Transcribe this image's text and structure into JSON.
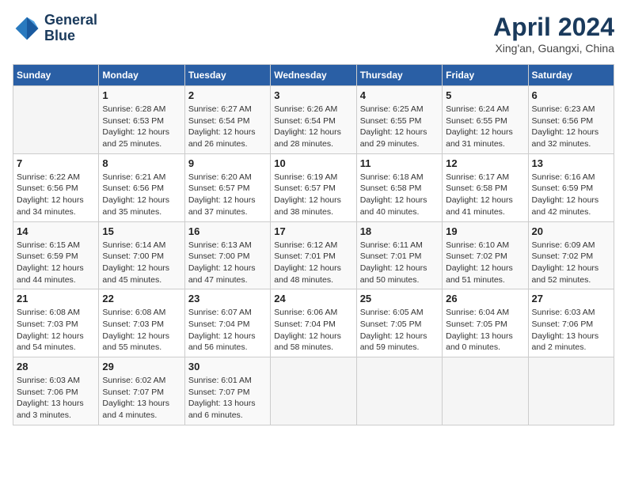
{
  "header": {
    "logo_line1": "General",
    "logo_line2": "Blue",
    "month": "April 2024",
    "location": "Xing'an, Guangxi, China"
  },
  "weekdays": [
    "Sunday",
    "Monday",
    "Tuesday",
    "Wednesday",
    "Thursday",
    "Friday",
    "Saturday"
  ],
  "weeks": [
    [
      {
        "day": "",
        "detail": ""
      },
      {
        "day": "1",
        "detail": "Sunrise: 6:28 AM\nSunset: 6:53 PM\nDaylight: 12 hours\nand 25 minutes."
      },
      {
        "day": "2",
        "detail": "Sunrise: 6:27 AM\nSunset: 6:54 PM\nDaylight: 12 hours\nand 26 minutes."
      },
      {
        "day": "3",
        "detail": "Sunrise: 6:26 AM\nSunset: 6:54 PM\nDaylight: 12 hours\nand 28 minutes."
      },
      {
        "day": "4",
        "detail": "Sunrise: 6:25 AM\nSunset: 6:55 PM\nDaylight: 12 hours\nand 29 minutes."
      },
      {
        "day": "5",
        "detail": "Sunrise: 6:24 AM\nSunset: 6:55 PM\nDaylight: 12 hours\nand 31 minutes."
      },
      {
        "day": "6",
        "detail": "Sunrise: 6:23 AM\nSunset: 6:56 PM\nDaylight: 12 hours\nand 32 minutes."
      }
    ],
    [
      {
        "day": "7",
        "detail": "Sunrise: 6:22 AM\nSunset: 6:56 PM\nDaylight: 12 hours\nand 34 minutes."
      },
      {
        "day": "8",
        "detail": "Sunrise: 6:21 AM\nSunset: 6:56 PM\nDaylight: 12 hours\nand 35 minutes."
      },
      {
        "day": "9",
        "detail": "Sunrise: 6:20 AM\nSunset: 6:57 PM\nDaylight: 12 hours\nand 37 minutes."
      },
      {
        "day": "10",
        "detail": "Sunrise: 6:19 AM\nSunset: 6:57 PM\nDaylight: 12 hours\nand 38 minutes."
      },
      {
        "day": "11",
        "detail": "Sunrise: 6:18 AM\nSunset: 6:58 PM\nDaylight: 12 hours\nand 40 minutes."
      },
      {
        "day": "12",
        "detail": "Sunrise: 6:17 AM\nSunset: 6:58 PM\nDaylight: 12 hours\nand 41 minutes."
      },
      {
        "day": "13",
        "detail": "Sunrise: 6:16 AM\nSunset: 6:59 PM\nDaylight: 12 hours\nand 42 minutes."
      }
    ],
    [
      {
        "day": "14",
        "detail": "Sunrise: 6:15 AM\nSunset: 6:59 PM\nDaylight: 12 hours\nand 44 minutes."
      },
      {
        "day": "15",
        "detail": "Sunrise: 6:14 AM\nSunset: 7:00 PM\nDaylight: 12 hours\nand 45 minutes."
      },
      {
        "day": "16",
        "detail": "Sunrise: 6:13 AM\nSunset: 7:00 PM\nDaylight: 12 hours\nand 47 minutes."
      },
      {
        "day": "17",
        "detail": "Sunrise: 6:12 AM\nSunset: 7:01 PM\nDaylight: 12 hours\nand 48 minutes."
      },
      {
        "day": "18",
        "detail": "Sunrise: 6:11 AM\nSunset: 7:01 PM\nDaylight: 12 hours\nand 50 minutes."
      },
      {
        "day": "19",
        "detail": "Sunrise: 6:10 AM\nSunset: 7:02 PM\nDaylight: 12 hours\nand 51 minutes."
      },
      {
        "day": "20",
        "detail": "Sunrise: 6:09 AM\nSunset: 7:02 PM\nDaylight: 12 hours\nand 52 minutes."
      }
    ],
    [
      {
        "day": "21",
        "detail": "Sunrise: 6:08 AM\nSunset: 7:03 PM\nDaylight: 12 hours\nand 54 minutes."
      },
      {
        "day": "22",
        "detail": "Sunrise: 6:08 AM\nSunset: 7:03 PM\nDaylight: 12 hours\nand 55 minutes."
      },
      {
        "day": "23",
        "detail": "Sunrise: 6:07 AM\nSunset: 7:04 PM\nDaylight: 12 hours\nand 56 minutes."
      },
      {
        "day": "24",
        "detail": "Sunrise: 6:06 AM\nSunset: 7:04 PM\nDaylight: 12 hours\nand 58 minutes."
      },
      {
        "day": "25",
        "detail": "Sunrise: 6:05 AM\nSunset: 7:05 PM\nDaylight: 12 hours\nand 59 minutes."
      },
      {
        "day": "26",
        "detail": "Sunrise: 6:04 AM\nSunset: 7:05 PM\nDaylight: 13 hours\nand 0 minutes."
      },
      {
        "day": "27",
        "detail": "Sunrise: 6:03 AM\nSunset: 7:06 PM\nDaylight: 13 hours\nand 2 minutes."
      }
    ],
    [
      {
        "day": "28",
        "detail": "Sunrise: 6:03 AM\nSunset: 7:06 PM\nDaylight: 13 hours\nand 3 minutes."
      },
      {
        "day": "29",
        "detail": "Sunrise: 6:02 AM\nSunset: 7:07 PM\nDaylight: 13 hours\nand 4 minutes."
      },
      {
        "day": "30",
        "detail": "Sunrise: 6:01 AM\nSunset: 7:07 PM\nDaylight: 13 hours\nand 6 minutes."
      },
      {
        "day": "",
        "detail": ""
      },
      {
        "day": "",
        "detail": ""
      },
      {
        "day": "",
        "detail": ""
      },
      {
        "day": "",
        "detail": ""
      }
    ]
  ]
}
